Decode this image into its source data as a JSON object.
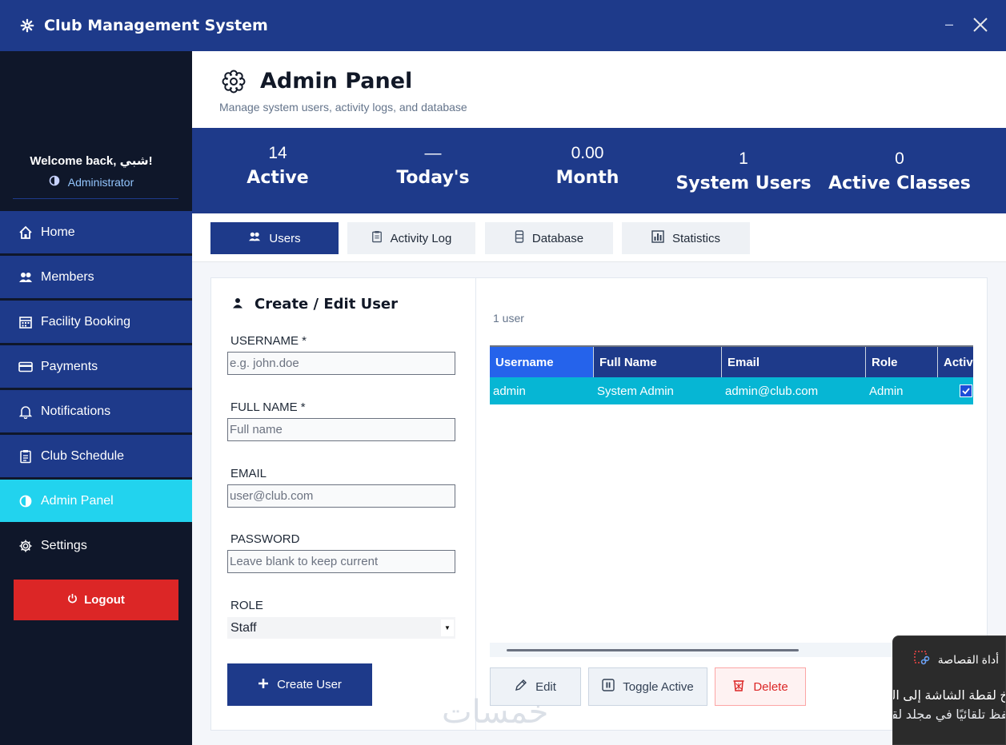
{
  "window": {
    "title": "Club Management System",
    "minimize_glyph": "–"
  },
  "sidebar": {
    "welcome": "Welcome back, شبي!",
    "role": "Administrator",
    "items": [
      {
        "label": "Home",
        "icon": "home-icon"
      },
      {
        "label": "Members",
        "icon": "users-icon"
      },
      {
        "label": "Facility Booking",
        "icon": "calendar-icon"
      },
      {
        "label": "Payments",
        "icon": "credit-card-icon"
      },
      {
        "label": "Notifications",
        "icon": "bell-icon"
      },
      {
        "label": "Club Schedule",
        "icon": "clipboard-icon"
      },
      {
        "label": "Admin Panel",
        "icon": "shield-icon",
        "active": true
      },
      {
        "label": "Settings",
        "icon": "gear-icon"
      }
    ],
    "logout": "Logout"
  },
  "header": {
    "title": "Admin Panel",
    "subtitle": "Manage system users, activity logs, and database"
  },
  "stats": [
    {
      "value": "14",
      "label": "Active"
    },
    {
      "value": "—",
      "label": "Today's"
    },
    {
      "value": "0.00",
      "label": "Month"
    },
    {
      "value": "1",
      "label": "System Users"
    },
    {
      "value": "0",
      "label": "Active Classes"
    }
  ],
  "tabs": [
    {
      "label": "Users",
      "active": true
    },
    {
      "label": "Activity Log"
    },
    {
      "label": "Database"
    },
    {
      "label": "Statistics"
    }
  ],
  "form": {
    "title": "Create / Edit User",
    "username_label": "USERNAME *",
    "username_placeholder": "e.g. john.doe",
    "fullname_label": "FULL NAME *",
    "fullname_placeholder": "Full name",
    "email_label": "EMAIL",
    "email_placeholder": "user@club.com",
    "password_label": "PASSWORD",
    "password_placeholder": "Leave blank to keep current",
    "role_label": "ROLE",
    "role_value": "Staff",
    "submit": "Create User"
  },
  "users_table": {
    "count": "1 user",
    "columns": [
      "Username",
      "Full Name",
      "Email",
      "Role",
      "Active"
    ],
    "rows": [
      {
        "username": "admin",
        "full_name": "System Admin",
        "email": "admin@club.com",
        "role": "Admin",
        "active": true
      }
    ]
  },
  "actions": {
    "edit": "Edit",
    "toggle": "Toggle Active",
    "delete": "Delete"
  },
  "watermark": "خمسات",
  "notification": {
    "title": "أداة القصاصة",
    "line1": "تم نسخ لقطة الشاشة إلى الحافظة.",
    "line2": "تم الحفظ تلقائيًا في مجلد لقطات الشاشة."
  },
  "colors": {
    "primary": "#1e3a8a",
    "sidebar_bg": "#0f172a",
    "active_nav": "#22d3ee",
    "selected_row": "#06b6d4",
    "danger": "#dc2626"
  }
}
